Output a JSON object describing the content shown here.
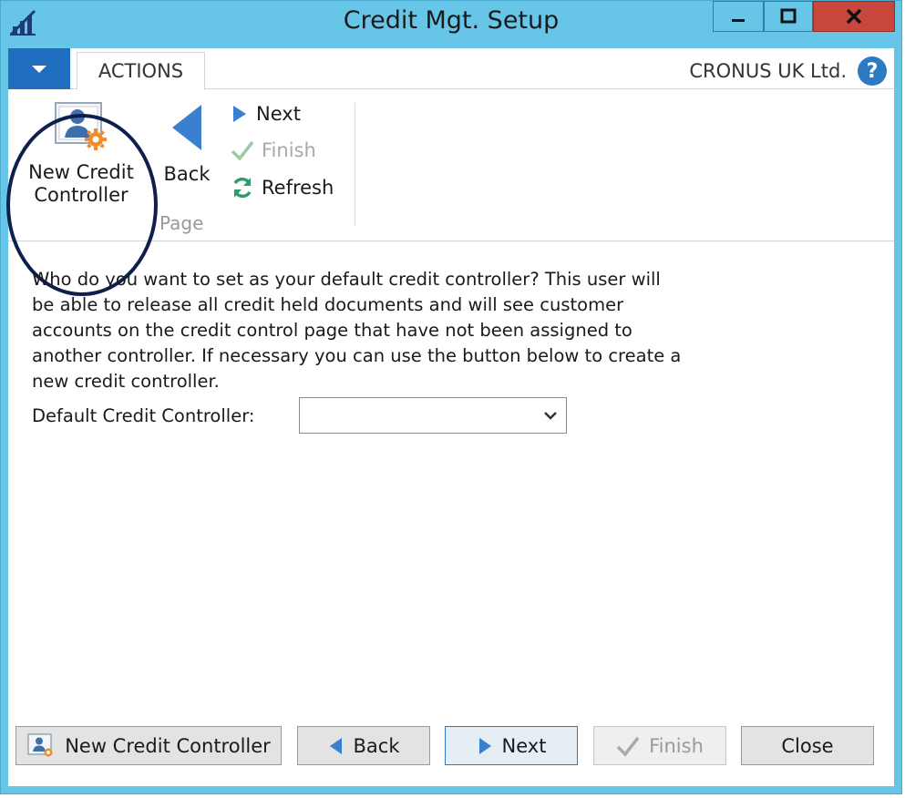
{
  "window": {
    "title": "Credit Mgt. Setup",
    "controls": {
      "minimize": "minimize",
      "maximize": "maximize",
      "close": "close"
    }
  },
  "tabs": {
    "actions_label": "ACTIONS"
  },
  "company": "CRONUS UK Ltd.",
  "help_label": "?",
  "ribbon": {
    "new_credit_controller_line1": "New Credit",
    "new_credit_controller_line2": "Controller",
    "back_label": "Back",
    "next_label": "Next",
    "finish_label": "Finish",
    "refresh_label": "Refresh",
    "group_label": "Page"
  },
  "content": {
    "instruction": "Who do you want to set as your default credit controller? This user will be able to release all credit held documents and will see customer accounts on the credit control page that have not been assigned to another controller. If necessary you can use the button below to create a new credit controller.",
    "field_label": "Default Credit Controller:",
    "field_value": ""
  },
  "footer": {
    "new_credit_controller": "New Credit Controller",
    "back": "Back",
    "next": "Next",
    "finish": "Finish",
    "close": "Close"
  },
  "colors": {
    "window_frame": "#67c5e8",
    "app_menu": "#1f6ebf",
    "close_button": "#c9463d",
    "annotation_ellipse": "#0e1f4d"
  },
  "icons": {
    "app": "chart-icon",
    "help": "help-icon",
    "new_credit_controller": "user-gear-icon",
    "back": "arrow-left-icon",
    "next": "arrow-right-icon",
    "finish": "checkmark-icon",
    "refresh": "refresh-icon"
  }
}
